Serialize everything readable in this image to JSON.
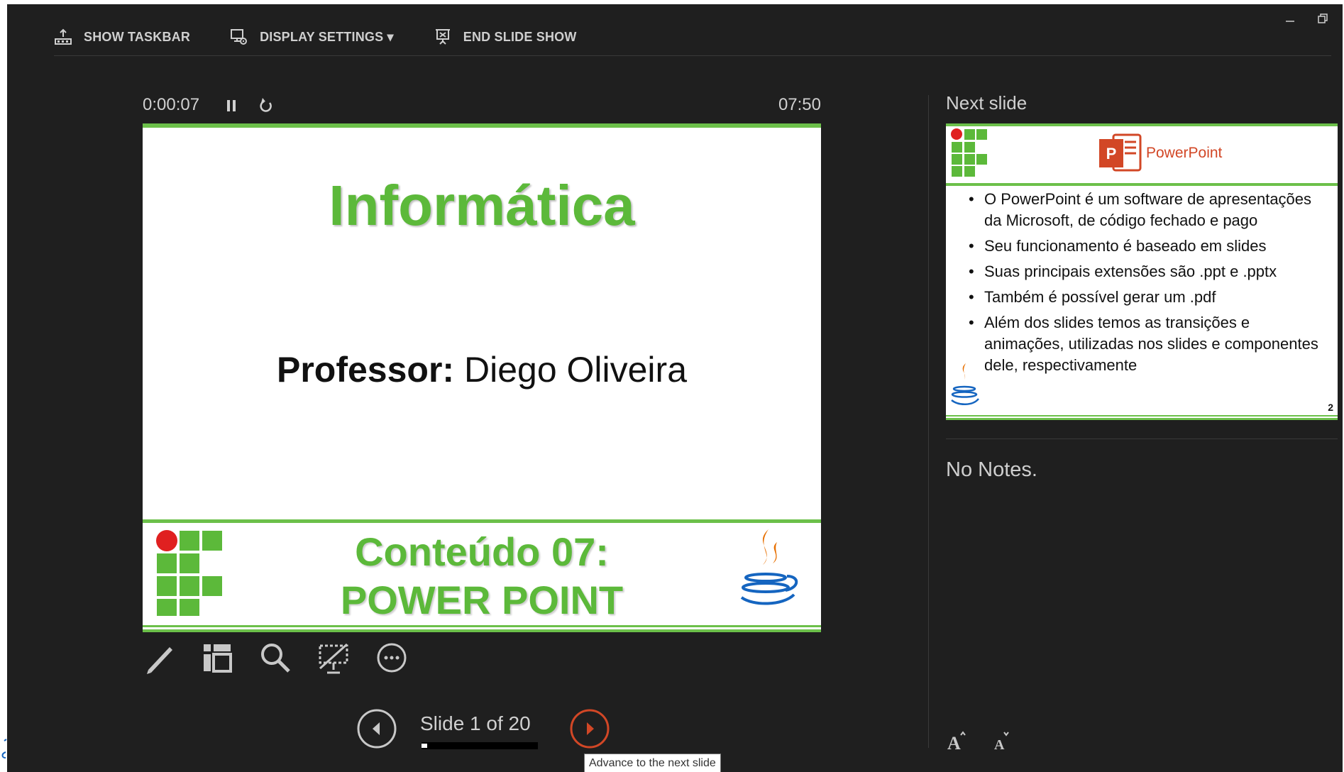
{
  "toolbar": {
    "show_taskbar": "SHOW TASKBAR",
    "display_settings": "DISPLAY SETTINGS ▾",
    "end_slide_show": "END SLIDE SHOW"
  },
  "timer": {
    "elapsed": "0:00:07",
    "clock": "07:50"
  },
  "current_slide": {
    "title": "Informática",
    "professor_label": "Professor:",
    "professor_name": "Diego Oliveira",
    "footer_line1": "Conteúdo 07:",
    "footer_line2": "POWER POINT"
  },
  "navigation": {
    "counter": "Slide 1 of 20",
    "progress_fraction": 0.05,
    "tooltip": "Advance to the next slide"
  },
  "next_slide": {
    "label": "Next slide",
    "brand": "PowerPoint",
    "bullets": [
      "O PowerPoint é um software de apresentações da Microsoft, de código fechado e pago",
      "Seu funcionamento é baseado em slides",
      "Suas principais extensões são .ppt e .pptx",
      "Também é possível gerar um .pdf",
      "Além dos slides temos as transições e animações, utilizadas nos slides e componentes dele, respectivamente"
    ],
    "page_number": "2"
  },
  "notes": {
    "text": "No Notes."
  },
  "colors": {
    "background": "#1f1f1f",
    "slide_green": "#5cb93a",
    "accent_orange": "#d24726",
    "if_red": "#e02020"
  },
  "icons": [
    "taskbar-icon",
    "display-settings-icon",
    "end-show-icon",
    "minimize-icon",
    "restore-icon",
    "pause-icon",
    "reset-icon",
    "pen-icon",
    "slides-grid-icon",
    "zoom-icon",
    "black-screen-icon",
    "more-options-icon",
    "previous-icon",
    "next-icon",
    "font-increase-icon",
    "font-decrease-icon"
  ]
}
